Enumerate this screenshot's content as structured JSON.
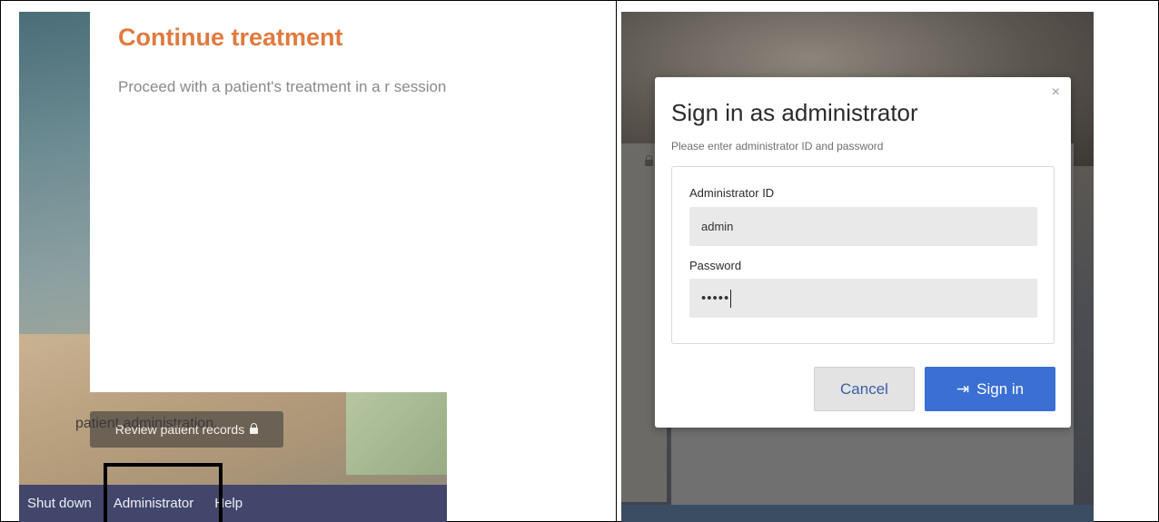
{
  "left": {
    "card_title": "Continue treatment",
    "card_description": "Proceed with a patient's treatment in a r session.",
    "review_button": "Review patient records",
    "footer": {
      "shut_down": "Shut down",
      "administrator": "Administrator",
      "help": "Help"
    }
  },
  "right": {
    "background_card_text": "patient administration.",
    "modal": {
      "title": "Sign in as administrator",
      "subtitle": "Please enter administrator ID and password",
      "close_glyph": "×",
      "admin_id_label": "Administrator ID",
      "admin_id_value": "admin",
      "password_label": "Password",
      "password_value": "•••••",
      "cancel_label": "Cancel",
      "signin_label": "Sign in",
      "signin_icon": "⇥"
    }
  },
  "colors": {
    "title_orange": "#e07a3f",
    "footer_bg": "#43466b",
    "primary_blue": "#3b6fd4"
  }
}
